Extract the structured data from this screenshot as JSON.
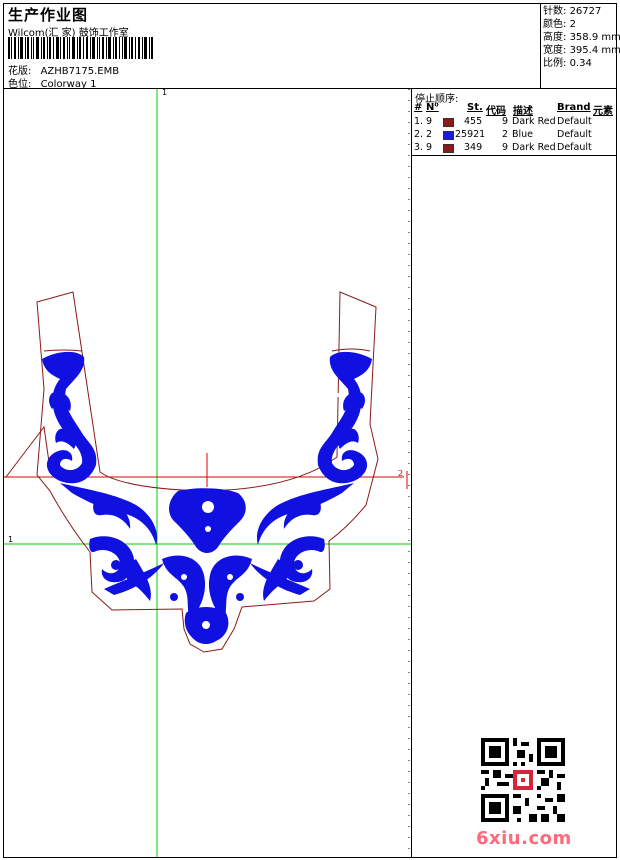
{
  "header": {
    "title": "生产作业图",
    "studio": "Wilcom(汇 家) 鼓饰工作室",
    "design_label": "花版:",
    "design_value": "AZHB7175.EMB",
    "colorway_label": "色位:",
    "colorway_value": "Colorway 1"
  },
  "stats": [
    {
      "label": "针数:",
      "value": "26727"
    },
    {
      "label": "颜色:",
      "value": "2"
    },
    {
      "label": "高度:",
      "value": "358.9 mm"
    },
    {
      "label": "宽度:",
      "value": "395.4 mm"
    },
    {
      "label": "比例:",
      "value": "0.34"
    }
  ],
  "stop_sequence": {
    "title": "停止顺序:",
    "headers": {
      "hash": "#",
      "no": "N⁰",
      "st": "St.",
      "code": "代码",
      "desc": "描述",
      "brand": "Brand",
      "element": "元素"
    },
    "rows": [
      {
        "index": "1.",
        "no": "9",
        "color": "#8b1a1a",
        "st": "455",
        "code": "9",
        "desc": "Dark Red",
        "brand": "Default"
      },
      {
        "index": "2.",
        "no": "2",
        "color": "#1a1ae6",
        "st": "25921",
        "code": "2",
        "desc": "Blue",
        "brand": "Default"
      },
      {
        "index": "3.",
        "no": "9",
        "color": "#8b1a1a",
        "st": "349",
        "code": "9",
        "desc": "Dark Red",
        "brand": "Default"
      }
    ]
  },
  "rulers": {
    "top": "1",
    "left": "1",
    "right": "2"
  },
  "watermark": "6xiu.com",
  "colors": {
    "outline": "#8b1a1a",
    "embroidery": "#1010e0",
    "guide_green": "#00cc00",
    "guide_red": "#e00000"
  }
}
